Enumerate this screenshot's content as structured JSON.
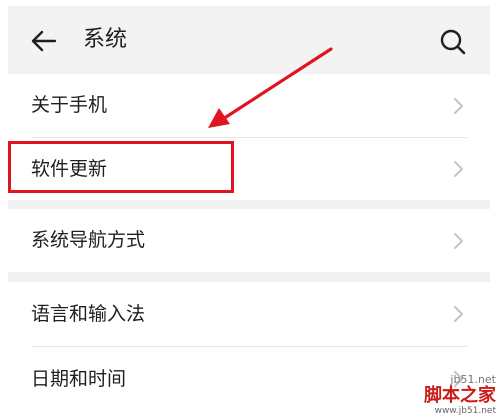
{
  "header": {
    "title": "系统",
    "back_icon": "arrow-left-icon",
    "search_icon": "search-icon"
  },
  "items": [
    {
      "label": "关于手机"
    },
    {
      "label": "软件更新"
    },
    {
      "label": "系统导航方式"
    },
    {
      "label": "语言和输入法"
    },
    {
      "label": "日期和时间"
    }
  ],
  "annotation": {
    "highlight_color": "#e0141f",
    "highlighted_item": "软件更新"
  },
  "watermark": {
    "url": "jb51.net",
    "name": "脚本之家",
    "domain": "www.jb51.net"
  }
}
